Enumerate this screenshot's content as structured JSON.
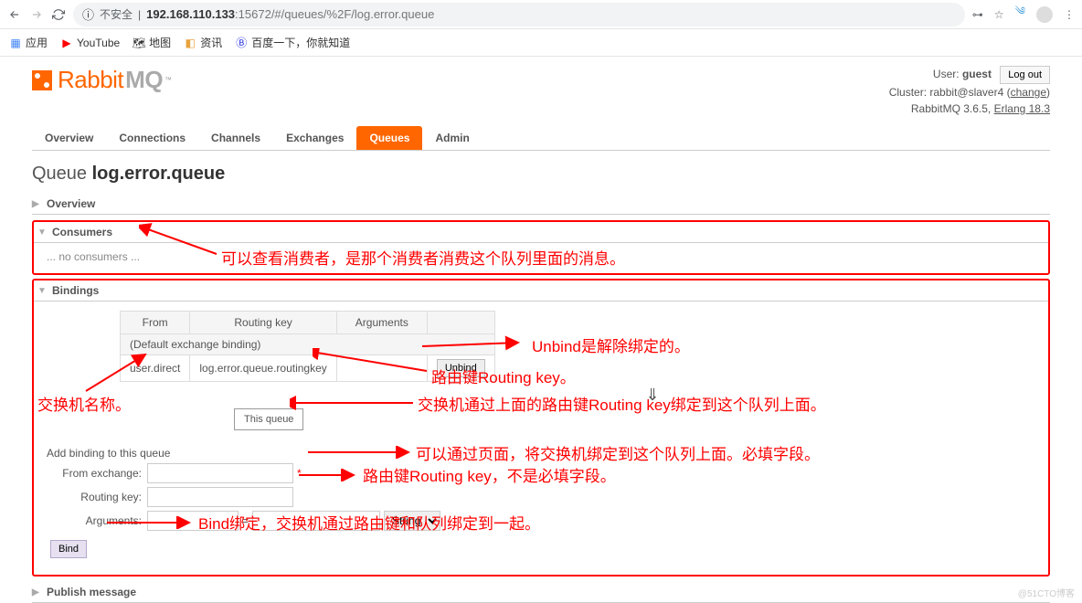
{
  "browser": {
    "insecure_label": "不安全",
    "host": "192.168.110.133",
    "port": ":15672",
    "path": "/#/queues/%2F/log.error.queue",
    "bookmarks": {
      "apps": "应用",
      "youtube": "YouTube",
      "maps": "地图",
      "news": "资讯",
      "baidu": "百度一下，你就知道"
    }
  },
  "header": {
    "logo_text": "Rabbit",
    "logo_mq": "MQ",
    "user_label": "User:",
    "user": "guest",
    "cluster_label": "Cluster:",
    "cluster": "rabbit@slaver4",
    "change": "change",
    "version": "RabbitMQ 3.6.5,",
    "erlang": "Erlang 18.3",
    "logout": "Log out"
  },
  "tabs": {
    "overview": "Overview",
    "connections": "Connections",
    "channels": "Channels",
    "exchanges": "Exchanges",
    "queues": "Queues",
    "admin": "Admin"
  },
  "title": {
    "prefix": "Queue",
    "name": "log.error.queue"
  },
  "sections": {
    "overview": "Overview",
    "consumers": "Consumers",
    "bindings": "Bindings",
    "publish": "Publish message"
  },
  "consumers": {
    "empty": "... no consumers ..."
  },
  "bindings": {
    "headers": {
      "from": "From",
      "routing_key": "Routing key",
      "arguments": "Arguments"
    },
    "default_row": "(Default exchange binding)",
    "rows": [
      {
        "from": "user.direct",
        "routing_key": "log.error.queue.routingkey",
        "arguments": "",
        "unbind": "Unbind"
      }
    ],
    "this_queue": "This queue",
    "add_title": "Add binding to this queue",
    "form": {
      "from_exchange": "From exchange:",
      "routing_key": "Routing key:",
      "arguments": "Arguments:",
      "eq": "=",
      "type": "String",
      "bind": "Bind"
    }
  },
  "annotations": {
    "a1": "可以查看消费者，是那个消费者消费这个队列里面的消息。",
    "a2": "Unbind是解除绑定的。",
    "a3": "路由键Routing key。",
    "a4": "交换机名称。",
    "a5": "交换机通过上面的路由键Routing key绑定到这个队列上面。",
    "a6": "可以通过页面，将交换机绑定到这个队列上面。必填字段。",
    "a7": "路由键Routing key，不是必填字段。",
    "a8": "Bind绑定，交换机通过路由键和队列绑定到一起。"
  },
  "watermark": "@51CTO博客"
}
